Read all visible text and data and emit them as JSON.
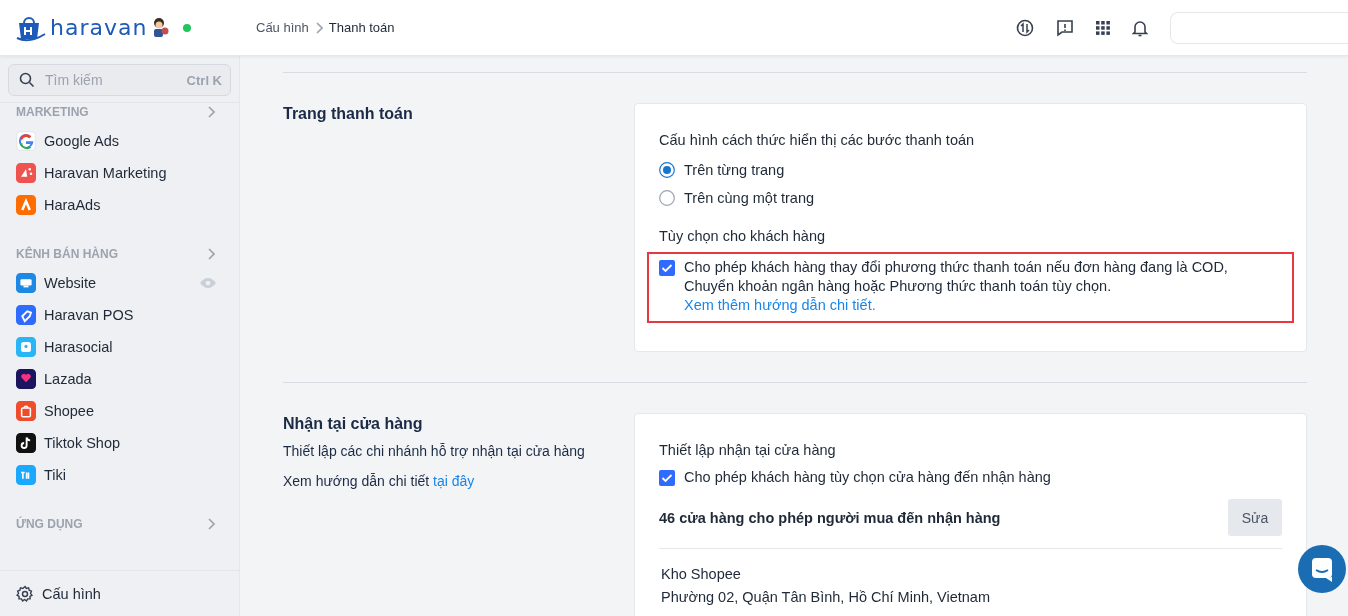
{
  "header": {
    "logo": "haravan",
    "online": true,
    "breadcrumb": [
      {
        "label": "Cấu hình"
      },
      {
        "label": "Thanh toán"
      }
    ]
  },
  "sidebar": {
    "search": {
      "placeholder": "Tìm kiếm",
      "shortcut": "Ctrl K"
    },
    "sections": [
      {
        "title": "MARKETING",
        "items": [
          {
            "label": "Google Ads",
            "kind": "google"
          },
          {
            "label": "Haravan Marketing",
            "kind": "marketing"
          },
          {
            "label": "HaraAds",
            "kind": "haraads"
          }
        ]
      },
      {
        "title": "KÊNH BÁN HÀNG",
        "items": [
          {
            "label": "Website",
            "kind": "website"
          },
          {
            "label": "Haravan POS",
            "kind": "pos"
          },
          {
            "label": "Harasocial",
            "kind": "harasocial"
          },
          {
            "label": "Lazada",
            "kind": "lazada"
          },
          {
            "label": "Shopee",
            "kind": "shopee"
          },
          {
            "label": "Tiktok Shop",
            "kind": "tiktok"
          },
          {
            "label": "Tiki",
            "kind": "tiki"
          }
        ]
      },
      {
        "title": "ỨNG DỤNG"
      }
    ],
    "footer": {
      "label": "Cấu hình"
    }
  },
  "sections": [
    {
      "title": "Trang thanh toán",
      "card": {
        "groups": [
          {
            "kind": "radio",
            "heading": "Cấu hình cách thức hiển thị các bước thanh toán",
            "options": [
              {
                "label": "Trên từng trang",
                "selected": true
              },
              {
                "label": "Trên cùng một trang",
                "selected": false
              }
            ]
          },
          {
            "kind": "checkbox",
            "heading": "Tùy chọn cho khách hàng",
            "options": [
              {
                "label": "Cho phép khách hàng thay đổi phương thức thanh toán nếu đơn hàng đang là COD, Chuyển khoản ngân hàng hoặc Phương thức thanh toán tùy chọn.",
                "link": "Xem thêm hướng dẫn chi tiết.",
                "checked": true,
                "highlighted": true
              }
            ]
          }
        ]
      }
    },
    {
      "title": "Nhận tại cửa hàng",
      "description": "Thiết lập các chi nhánh hỗ trợ nhận tại cửa hàng",
      "help": {
        "text": "Xem hướng dẫn chi tiết",
        "link": "tại đây"
      },
      "card": {
        "groups": [
          {
            "kind": "checkbox",
            "heading": "Thiết lập nhận tại cửa hàng",
            "options": [
              {
                "label": "Cho phép khách hàng tùy chọn cửa hàng đến nhận hàng",
                "checked": true,
                "highlighted": false
              }
            ]
          },
          {
            "kind": "stores",
            "summary": "46 cửa hàng cho phép người mua đến nhận hàng",
            "action": "Sửa",
            "stores": [
              {
                "name": "Kho Shopee",
                "address": "Phường 02, Quận Tân Bình, Hồ Chí Minh, Vietnam"
              }
            ]
          }
        ]
      }
    }
  ]
}
